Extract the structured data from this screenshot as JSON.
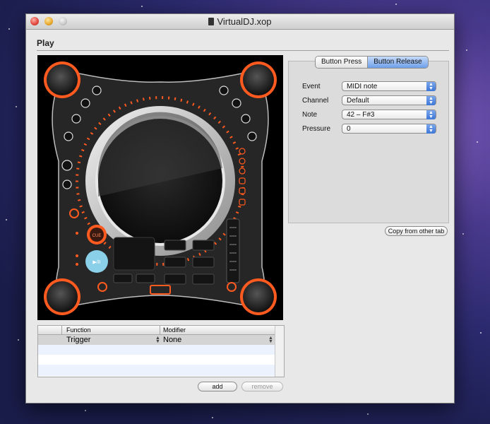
{
  "window": {
    "title": "VirtualDJ.xop"
  },
  "section_title": "Play",
  "tabs": [
    {
      "label": "Button Press",
      "active": false
    },
    {
      "label": "Button Release",
      "active": true
    }
  ],
  "fields": [
    {
      "label": "Event",
      "value": "MIDI note"
    },
    {
      "label": "Channel",
      "value": "Default"
    },
    {
      "label": "Note",
      "value": "42 – F#3"
    },
    {
      "label": "Pressure",
      "value": "0"
    }
  ],
  "copy_button": "Copy from other tab",
  "table": {
    "headers": [
      "Function",
      "Modifier"
    ],
    "rows": [
      {
        "function": "Trigger",
        "modifier": "None"
      }
    ]
  },
  "buttons": {
    "add": "add",
    "remove": "remove"
  },
  "device": {
    "center_button_label": "CUE",
    "play_button_label": "▶/II",
    "colors": {
      "accent": "#ff5a1f",
      "play": "#8ad0e8",
      "platter": "#c8c8c8"
    }
  }
}
